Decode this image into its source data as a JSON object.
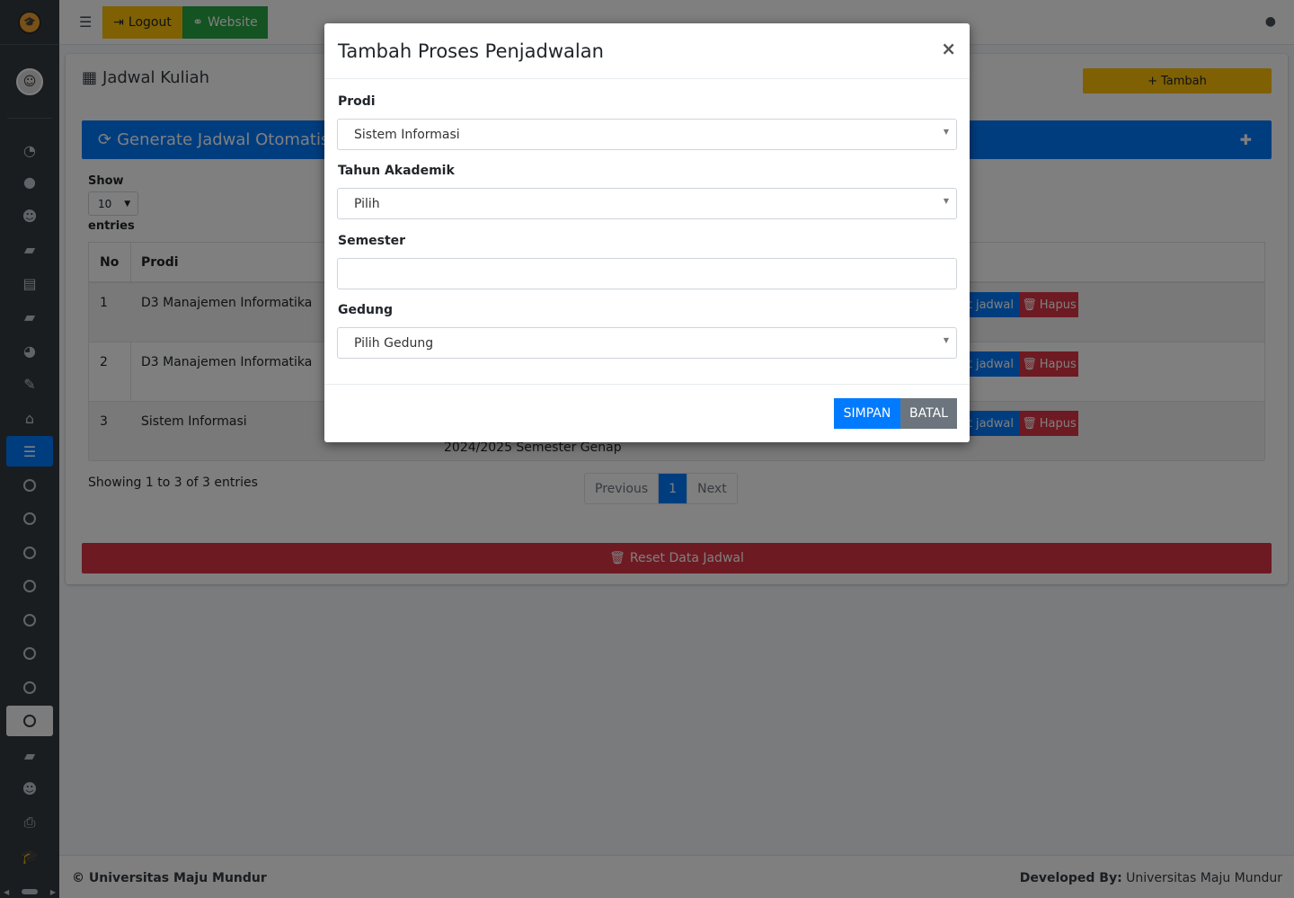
{
  "topbar": {
    "menu_icon": "bars-icon",
    "logout_label": "Logout",
    "website_label": "Website",
    "user_icon": "user-icon"
  },
  "sidebar": {
    "items": [
      {
        "icon": "dashboard-icon",
        "glyph": "◔"
      },
      {
        "icon": "user-icon",
        "glyph": "●"
      },
      {
        "icon": "users-icon",
        "glyph": "☻"
      },
      {
        "icon": "book-icon",
        "glyph": "▰"
      },
      {
        "icon": "newspaper-icon",
        "glyph": "▤"
      },
      {
        "icon": "book-icon",
        "glyph": "▰"
      },
      {
        "icon": "pie-chart-icon",
        "glyph": "◕"
      },
      {
        "icon": "edit-icon",
        "glyph": "✎"
      },
      {
        "icon": "institution-icon",
        "glyph": "⌂"
      },
      {
        "icon": "tasks-icon",
        "glyph": "☰"
      },
      {
        "icon": "circle-icon"
      },
      {
        "icon": "circle-icon"
      },
      {
        "icon": "circle-icon"
      },
      {
        "icon": "circle-icon"
      },
      {
        "icon": "circle-icon"
      },
      {
        "icon": "circle-icon"
      },
      {
        "icon": "circle-icon"
      },
      {
        "icon": "circle-icon"
      },
      {
        "icon": "book-icon",
        "glyph": "▰"
      },
      {
        "icon": "users-icon",
        "glyph": "☻"
      },
      {
        "icon": "print-icon",
        "glyph": "⎙"
      },
      {
        "icon": "graduation-cap-icon",
        "glyph": "🎓"
      }
    ]
  },
  "page": {
    "title": "Jadwal Kuliah",
    "tambah_label": "Tambah",
    "generate_label": "Generate Jadwal Otomatis",
    "show_label": "Show",
    "show_value": "10",
    "entries_label": "entries",
    "table": {
      "headers": [
        "No",
        "Prodi"
      ],
      "rows": [
        {
          "no": "1",
          "prodi": "D3 Manajemen Informatika",
          "edit": "it jadwal",
          "hapus": "Hapus"
        },
        {
          "no": "2",
          "prodi": "D3 Manajemen Informatika",
          "edit": "it jadwal",
          "hapus": "Hapus"
        },
        {
          "no": "3",
          "prodi": "Sistem Informasi",
          "edit": "it jadwal",
          "hapus": "Hapus"
        }
      ],
      "semester_peek": "2024/2025 Semester Genap"
    },
    "showing_text": "Showing 1 to 3 of 3 entries",
    "pager": {
      "previous": "Previous",
      "current": "1",
      "next": "Next"
    },
    "reset_label": "Reset Data Jadwal"
  },
  "footer": {
    "left": "© Universitas Maju Mundur",
    "right_label": "Developed By:",
    "right_value": "Universitas Maju Mundur"
  },
  "modal": {
    "title": "Tambah Proses Penjadwalan",
    "close": "×",
    "prodi_label": "Prodi",
    "prodi_value": "Sistem Informasi",
    "tahun_label": "Tahun Akademik",
    "tahun_value": "Pilih",
    "semester_label": "Semester",
    "semester_value": "",
    "gedung_label": "Gedung",
    "gedung_value": "Pilih Gedung",
    "simpan_label": "SIMPAN",
    "batal_label": "BATAL"
  }
}
